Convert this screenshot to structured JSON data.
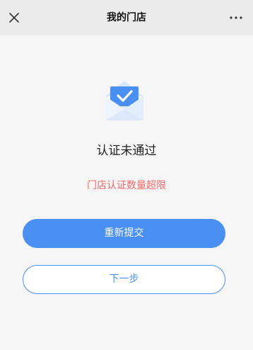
{
  "header": {
    "title": "我的门店",
    "close_icon": "close-icon",
    "more_icon": "more-icon"
  },
  "status": {
    "icon": "envelope-check-icon",
    "title": "认证未通过",
    "reason": "门店认证数量超限"
  },
  "actions": {
    "resubmit_label": "重新提交",
    "next_label": "下一步"
  },
  "colors": {
    "accent": "#4a90f2",
    "error": "#f06a6a",
    "nav_background": "#ebebeb",
    "page_background": "#f6f6f6"
  }
}
